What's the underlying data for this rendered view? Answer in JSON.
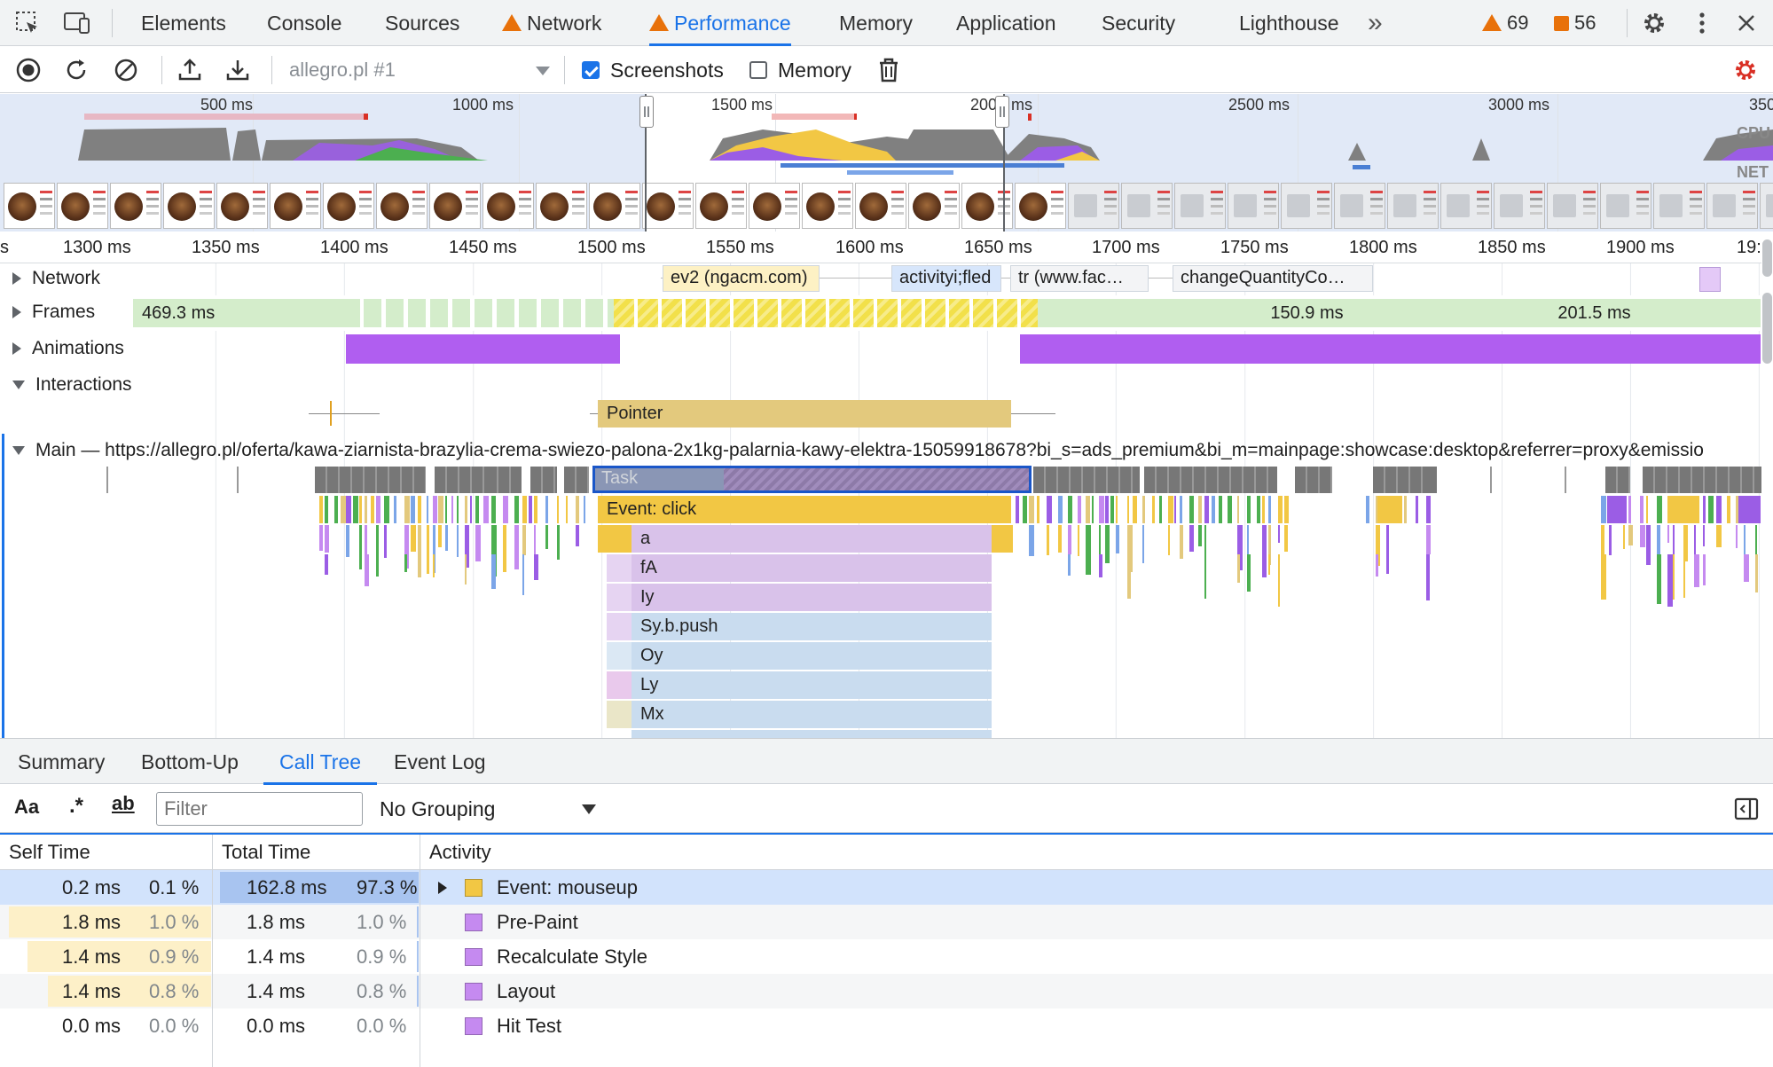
{
  "tabs": [
    {
      "label": "Elements"
    },
    {
      "label": "Console"
    },
    {
      "label": "Sources"
    },
    {
      "label": "Network",
      "warning": true
    },
    {
      "label": "Performance",
      "warning": true,
      "active": true
    },
    {
      "label": "Memory"
    },
    {
      "label": "Application"
    },
    {
      "label": "Security"
    },
    {
      "label": "Lighthouse"
    }
  ],
  "overflow_label": "»",
  "warnings_count": "69",
  "issues_count": "56",
  "toolbar": {
    "profile_select": "allegro.pl #1",
    "screenshots_label": "Screenshots",
    "screenshots_checked": true,
    "memory_label": "Memory",
    "memory_checked": false
  },
  "overview": {
    "ticks": [
      "500 ms",
      "1000 ms",
      "1500 ms",
      "200",
      "ms",
      "2500 ms",
      "3000 ms",
      "350"
    ],
    "cpu_label": "CPU",
    "net_label": "NET"
  },
  "ruler": {
    "ticks": [
      "s",
      "1300 ms",
      "1350 ms",
      "1400 ms",
      "1450 ms",
      "1500 ms",
      "1550 ms",
      "1600 ms",
      "1650 ms",
      "1700 ms",
      "1750 ms",
      "1800 ms",
      "1850 ms",
      "1900 ms",
      "19:"
    ]
  },
  "tracks": {
    "network": "Network",
    "frames": "Frames",
    "animations": "Animations",
    "interactions": "Interactions",
    "main": "Main — https://allegro.pl/oferta/kawa-ziarnista-brazylia-crema-swiezo-palona-2x1kg-palarnia-kawy-elektra-15059918678?bi_s=ads_premium&bi_m=mainpage:showcase:desktop&referrer=proxy&emissio"
  },
  "network_items": [
    "ev2 (ngacm.com)",
    "activityi;fled",
    "tr (www.fac…",
    "changeQuantityCo…"
  ],
  "frames": [
    "469.3 ms",
    "150.9 ms",
    "201.5 ms"
  ],
  "interaction_label": "Pointer",
  "flame": [
    "Task",
    "Event: click",
    "a",
    "fA",
    "Iy",
    "Sy.b.push",
    "Oy",
    "Ly",
    "Mx"
  ],
  "bottom_tabs": [
    {
      "label": "Summary"
    },
    {
      "label": "Bottom-Up"
    },
    {
      "label": "Call Tree",
      "active": true
    },
    {
      "label": "Event Log"
    }
  ],
  "filter": {
    "match_case": "Aa",
    "regex": ".*",
    "whole_word": "ab",
    "placeholder": "Filter",
    "grouping": "No Grouping"
  },
  "columns": {
    "self": "Self Time",
    "total": "Total Time",
    "activity": "Activity"
  },
  "rows": [
    {
      "self_time": "0.2 ms",
      "self_pct": "0.1 %",
      "total_time": "162.8 ms",
      "total_pct": "97.3 %",
      "activity": "Event: mouseup",
      "color": "#f2c744",
      "expandable": true,
      "selected": true
    },
    {
      "self_time": "1.8 ms",
      "self_pct": "1.0 %",
      "total_time": "1.8 ms",
      "total_pct": "1.0 %",
      "activity": "Pre-Paint",
      "color": "#c58af0"
    },
    {
      "self_time": "1.4 ms",
      "self_pct": "0.9 %",
      "total_time": "1.4 ms",
      "total_pct": "0.9 %",
      "activity": "Recalculate Style",
      "color": "#c58af0"
    },
    {
      "self_time": "1.4 ms",
      "self_pct": "0.8 %",
      "total_time": "1.4 ms",
      "total_pct": "0.8 %",
      "activity": "Layout",
      "color": "#c58af0"
    },
    {
      "self_time": "0.0 ms",
      "self_pct": "0.0 %",
      "total_time": "0.0 ms",
      "total_pct": "0.0 %",
      "activity": "Hit Test",
      "color": "#c58af0"
    }
  ],
  "colors": {
    "accent": "#1a73e8",
    "warning": "#e8710a",
    "scripting": "#f2c744",
    "rendering": "#c58af0",
    "selected_row": "#d2e3fc"
  }
}
